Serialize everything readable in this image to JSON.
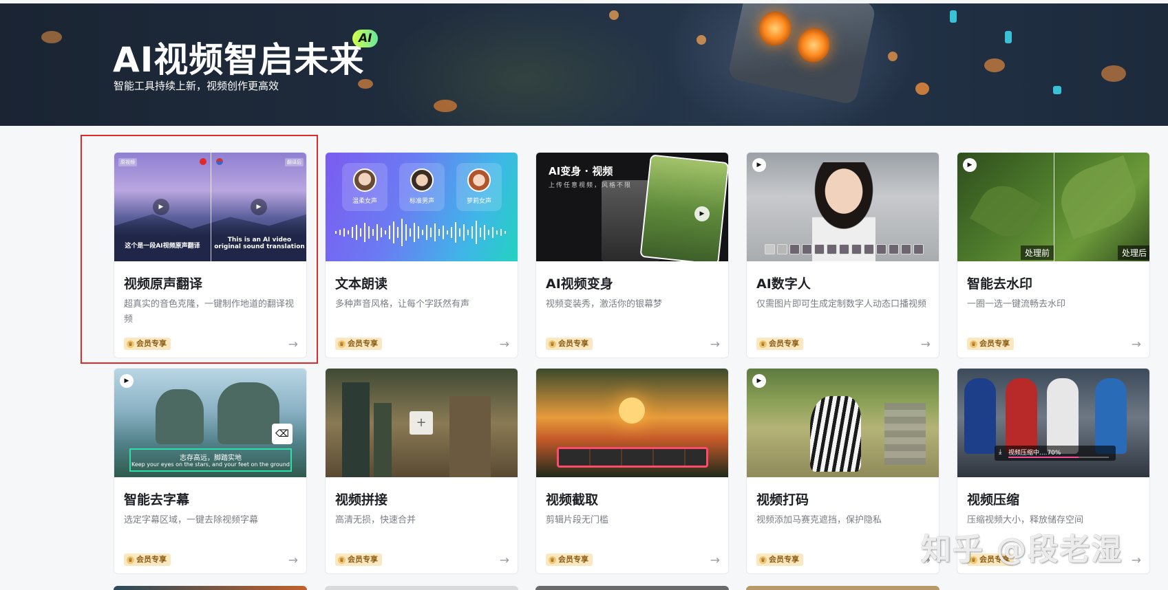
{
  "hero": {
    "title": "AI视频智启未来",
    "badge": "AI",
    "subtitle": "智能工具持续上新，视频创作更高效"
  },
  "vip_label": "会员专享",
  "arrow_glyph": "→",
  "cards": [
    {
      "title": "视频原声翻译",
      "desc": "超真实的音色克隆，一键制作地道的翻译视频",
      "thumb": {
        "left_tag": "原视频",
        "right_tag": "翻译后",
        "left_caption": "这个是一段AI视频原声翻译",
        "right_caption": "This is an AI video original sound translation"
      }
    },
    {
      "title": "文本朗读",
      "desc": "多种声音风格，让每个字跃然有声",
      "thumb": {
        "voices": [
          "温柔女声",
          "标准男声",
          "萝莉女声"
        ]
      }
    },
    {
      "title": "AI视频变身",
      "desc": "视频变装秀，激活你的银幕梦",
      "thumb": {
        "heading": "AI变身 · 视频",
        "subheading": "上传任意视频，风格不限"
      }
    },
    {
      "title": "AI数字人",
      "desc": "仅需图片即可生成定制数字人动态口播视频",
      "thumb": {}
    },
    {
      "title": "智能去水印",
      "desc": "一圈一选一键流畅去水印",
      "thumb": {
        "before": "处理前",
        "after": "处理后"
      }
    },
    {
      "title": "智能去字幕",
      "desc": "选定字幕区域，一键去除视频字幕",
      "thumb": {
        "caption_cn": "志存高远，脚踏实地",
        "caption_en": "Keep your eyes on the stars, and your feet on the ground"
      }
    },
    {
      "title": "视频拼接",
      "desc": "高清无损，快速合并",
      "thumb": {
        "plus": "+"
      }
    },
    {
      "title": "视频截取",
      "desc": "剪辑片段无门槛",
      "thumb": {}
    },
    {
      "title": "视频打码",
      "desc": "视频添加马赛克遮挡，保护隐私",
      "thumb": {}
    },
    {
      "title": "视频压缩",
      "desc": "压缩视频大小，释放储存空间",
      "thumb": {
        "progress_text": "视频压缩中....70%",
        "progress": 0.7
      }
    }
  ],
  "watermark": "知乎 @段老湿",
  "colors": {
    "selection_frame": "#e02a2a",
    "vip_bg": "#fbe8c0",
    "vip_text": "#8a5a12"
  }
}
